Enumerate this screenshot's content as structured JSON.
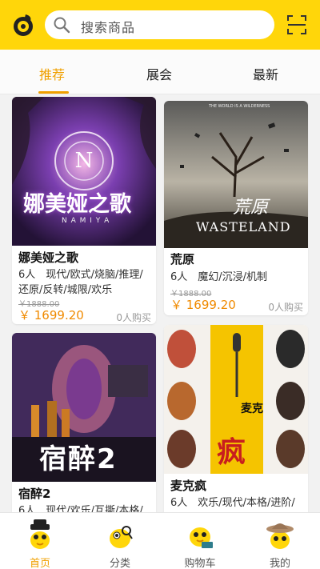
{
  "search": {
    "placeholder": "搜索商品"
  },
  "tabs": [
    {
      "label": "推荐",
      "active": true
    },
    {
      "label": "展会",
      "active": false
    },
    {
      "label": "最新",
      "active": false
    }
  ],
  "products": [
    {
      "title": "娜美娅之歌",
      "tags": "6人　现代/欧式/烧脑/推理/还原/反转/城限/欢乐",
      "old_price": "￥1888.00",
      "price": "￥ 1699.20",
      "sold": "0人购买",
      "poster_texts": {
        "big": "娜美娅之歌",
        "small": "N A M I Y A"
      }
    },
    {
      "title": "荒原",
      "tags": "6人　魔幻/沉浸/机制",
      "old_price": "￥1888.00",
      "price": "￥ 1699.20",
      "sold": "0人购买",
      "poster_texts": {
        "top": "THE WORLD IS A WILDERNESS",
        "big": "荒原",
        "small": "WASTELAND"
      }
    },
    {
      "title": "宿醉2",
      "tags": "6人　现代/欢乐/互撕/本格/",
      "poster_texts": {
        "big": "宿醉2"
      }
    },
    {
      "title": "麦克疯",
      "tags": "6人　欢乐/现代/本格/进阶/",
      "poster_texts": {
        "big": "疯",
        "small": "麦克"
      }
    }
  ],
  "nav": [
    {
      "label": "首页",
      "active": true,
      "icon": "home-mascot-icon"
    },
    {
      "label": "分类",
      "active": false,
      "icon": "category-mascot-icon"
    },
    {
      "label": "购物车",
      "active": false,
      "icon": "cart-mascot-icon"
    },
    {
      "label": "我的",
      "active": false,
      "icon": "profile-mascot-icon"
    }
  ],
  "colors": {
    "brand": "#ffd60a",
    "accent": "#f0a000",
    "price": "#f08a00"
  }
}
